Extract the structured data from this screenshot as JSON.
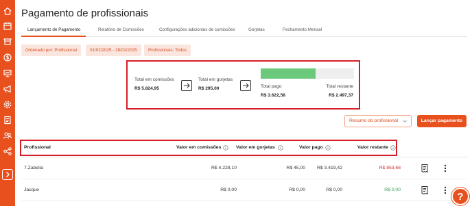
{
  "page": {
    "title": "Pagamento de profissionais"
  },
  "tabs": [
    {
      "label": "Lançamento de Pagamento",
      "active": true
    },
    {
      "label": "Relatório de Comissões",
      "active": false
    },
    {
      "label": "Configurações adicionais de comissões",
      "active": false
    },
    {
      "label": "Gorjetas",
      "active": false
    },
    {
      "label": "Fechamento Mensal",
      "active": false
    }
  ],
  "filters": {
    "order": "Ordenado por: Profissional",
    "date_range": "01/02/2025 - 28/02/2025",
    "professionals": "Profissionais: Todos"
  },
  "summary": {
    "commissions_label": "Total em comissões",
    "commissions_value": "R$ 5.824,95",
    "tips_label": "Total em gorjetas",
    "tips_value": "R$ 295,00",
    "paid_label": "Total pago",
    "paid_value": "R$ 3.622,58",
    "remaining_label": "Total restante",
    "remaining_value": "R$ 2.497,37",
    "paid_fraction": 0.59
  },
  "actions": {
    "summary_dropdown": "Resumo do profissional",
    "launch_payment": "Lançar pagamento"
  },
  "table": {
    "columns": [
      "Profissional",
      "Valor em comissões",
      "Valor em gorjetas",
      "Valor pago",
      "Valor restante"
    ],
    "rows": [
      {
        "name": "7.Zabella",
        "commissions": "R$ 4.228,10",
        "tips": "R$ 45,00",
        "paid": "R$ 3.419,42",
        "remaining": "R$ 853,68",
        "remaining_color": "#d32f2f"
      },
      {
        "name": "Jacque",
        "commissions": "R$ 0,00",
        "tips": "R$ 0,00",
        "paid": "R$ 0,00",
        "remaining": "R$ 0,00",
        "remaining_color": "#2e9e4f"
      }
    ]
  },
  "colors": {
    "accent": "#e8501e",
    "highlight_border": "#d81b26",
    "progress": "#6ac97b"
  },
  "icons": [
    "home-icon",
    "calendar-icon",
    "store-icon",
    "money-icon",
    "chart-icon",
    "megaphone-icon",
    "gear-icon",
    "clipboard-icon",
    "users-icon",
    "share-icon",
    "chevron-right-icon",
    "arrow-right-icon",
    "info-icon",
    "receipt-icon",
    "more-vertical-icon",
    "help-icon"
  ]
}
